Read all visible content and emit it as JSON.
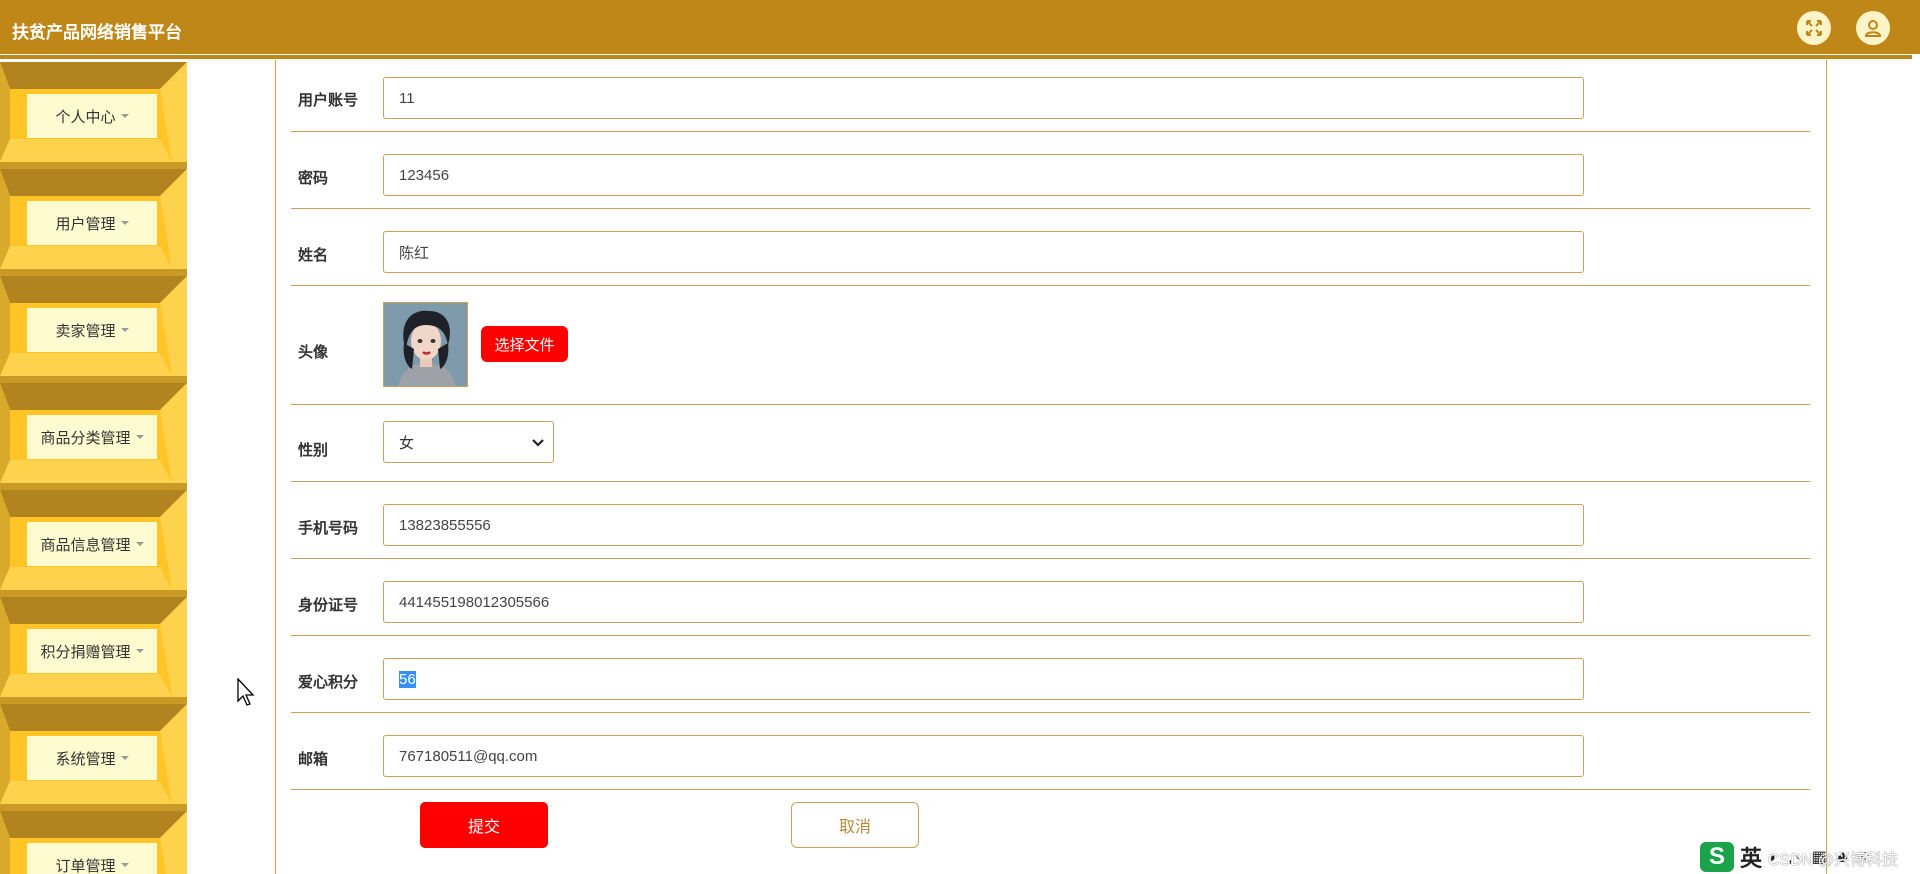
{
  "app": {
    "title": "扶贫产品网络销售平台"
  },
  "header": {
    "icons": [
      "fullscreen-icon",
      "user-icon"
    ]
  },
  "sidebar": {
    "items": [
      {
        "label": "个人中心"
      },
      {
        "label": "用户管理"
      },
      {
        "label": "卖家管理"
      },
      {
        "label": "商品分类管理"
      },
      {
        "label": "商品信息管理"
      },
      {
        "label": "积分捐赠管理"
      },
      {
        "label": "系统管理"
      },
      {
        "label": "订单管理"
      }
    ]
  },
  "form": {
    "account": {
      "label": "用户账号",
      "value": "11"
    },
    "password": {
      "label": "密码",
      "value": "123456"
    },
    "name": {
      "label": "姓名",
      "value": "陈红"
    },
    "avatar": {
      "label": "头像",
      "button": "选择文件"
    },
    "gender": {
      "label": "性别",
      "value": "女"
    },
    "phone": {
      "label": "手机号码",
      "value": "13823855556"
    },
    "idcard": {
      "label": "身份证号",
      "value": "441455198012305566"
    },
    "points": {
      "label": "爱心积分",
      "value": "56"
    },
    "email": {
      "label": "邮箱",
      "value": "767180511@qq.com"
    }
  },
  "actions": {
    "submit": "提交",
    "cancel": "取消"
  },
  "ime": {
    "logo": "S",
    "lang": "英",
    "glyphs": "◗ ,◦ ▦ ♣ ⁘"
  },
  "watermark": "CSDN @兴博科技",
  "colors": {
    "header": "#be8717",
    "sidebar_light": "#ffc426",
    "sidebar_dark": "#b18420",
    "menu_label_bg": "#fffbd0",
    "border": "#c9a257",
    "primary_button": "#ff0000"
  }
}
